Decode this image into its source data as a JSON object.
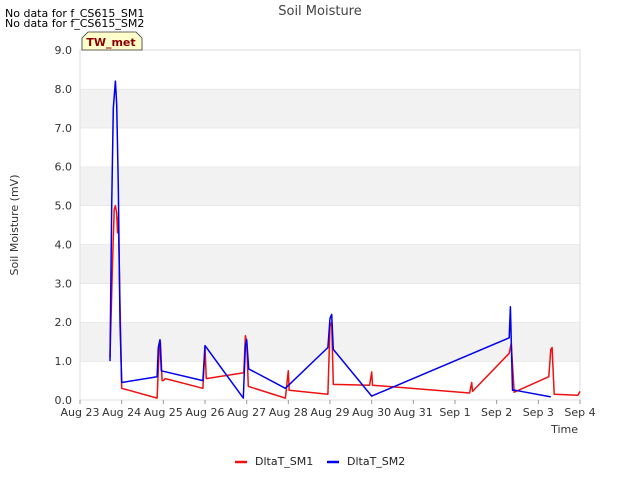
{
  "notes": [
    "No data for f_CS615_SM1",
    "No data for f_CS615_SM2"
  ],
  "badge": "TW_met",
  "chart_data": {
    "type": "line",
    "title": "Soil Moisture",
    "xlabel": "Time",
    "ylabel": "Soil Moisture (mV)",
    "x_ticks": [
      "Aug 23",
      "Aug 24",
      "Aug 25",
      "Aug 26",
      "Aug 27",
      "Aug 28",
      "Aug 29",
      "Aug 30",
      "Aug 31",
      "Sep 1",
      "Sep 2",
      "Sep 3",
      "Sep 4"
    ],
    "xlim": [
      0,
      12
    ],
    "y_ticks": [
      "0.0",
      "1.0",
      "2.0",
      "3.0",
      "4.0",
      "5.0",
      "6.0",
      "7.0",
      "8.0",
      "9.0"
    ],
    "ylim": [
      0,
      9
    ],
    "grid": "horizontal bands",
    "legend_position": "bottom",
    "series": [
      {
        "name": "DltaT_SM1",
        "color": "#ee1111",
        "points": [
          [
            0.72,
            1.1
          ],
          [
            0.78,
            3.5
          ],
          [
            0.82,
            4.9
          ],
          [
            0.85,
            5.0
          ],
          [
            0.88,
            4.8
          ],
          [
            0.9,
            4.3
          ],
          [
            0.92,
            4.7
          ],
          [
            0.95,
            3.0
          ],
          [
            1.0,
            0.3
          ],
          [
            1.85,
            0.05
          ],
          [
            1.9,
            1.3
          ],
          [
            1.93,
            1.5
          ],
          [
            1.97,
            0.5
          ],
          [
            2.0,
            0.5
          ],
          [
            2.05,
            0.55
          ],
          [
            2.95,
            0.3
          ],
          [
            3.0,
            1.35
          ],
          [
            3.03,
            0.55
          ],
          [
            3.93,
            0.7
          ],
          [
            3.97,
            1.65
          ],
          [
            4.0,
            1.5
          ],
          [
            4.04,
            0.35
          ],
          [
            4.93,
            0.05
          ],
          [
            5.0,
            0.75
          ],
          [
            5.02,
            0.25
          ],
          [
            5.95,
            0.15
          ],
          [
            6.0,
            1.9
          ],
          [
            6.04,
            2.0
          ],
          [
            6.08,
            0.4
          ],
          [
            6.95,
            0.38
          ],
          [
            7.0,
            0.72
          ],
          [
            7.02,
            0.38
          ],
          [
            9.35,
            0.18
          ],
          [
            9.4,
            0.45
          ],
          [
            9.42,
            0.22
          ],
          [
            10.3,
            1.2
          ],
          [
            10.35,
            1.45
          ],
          [
            10.42,
            0.2
          ],
          [
            11.25,
            0.6
          ],
          [
            11.3,
            1.3
          ],
          [
            11.33,
            1.35
          ],
          [
            11.38,
            0.15
          ],
          [
            11.95,
            0.12
          ],
          [
            12.0,
            0.22
          ]
        ]
      },
      {
        "name": "DltaT_SM2",
        "color": "#0000ee",
        "points": [
          [
            0.72,
            1.0
          ],
          [
            0.76,
            5.0
          ],
          [
            0.8,
            7.5
          ],
          [
            0.85,
            8.2
          ],
          [
            0.88,
            7.6
          ],
          [
            0.92,
            5.5
          ],
          [
            0.96,
            2.0
          ],
          [
            1.0,
            0.45
          ],
          [
            1.85,
            0.6
          ],
          [
            1.88,
            1.35
          ],
          [
            1.92,
            1.55
          ],
          [
            1.95,
            0.75
          ],
          [
            2.95,
            0.5
          ],
          [
            3.0,
            1.4
          ],
          [
            3.92,
            0.05
          ],
          [
            3.97,
            1.4
          ],
          [
            4.0,
            1.55
          ],
          [
            4.05,
            0.8
          ],
          [
            4.93,
            0.3
          ],
          [
            5.95,
            1.35
          ],
          [
            6.0,
            2.1
          ],
          [
            6.04,
            2.2
          ],
          [
            6.08,
            1.3
          ],
          [
            7.0,
            0.1
          ],
          [
            10.3,
            1.6
          ],
          [
            10.33,
            2.4
          ],
          [
            10.38,
            0.25
          ],
          [
            10.45,
            0.25
          ],
          [
            11.3,
            0.08
          ]
        ]
      }
    ]
  }
}
